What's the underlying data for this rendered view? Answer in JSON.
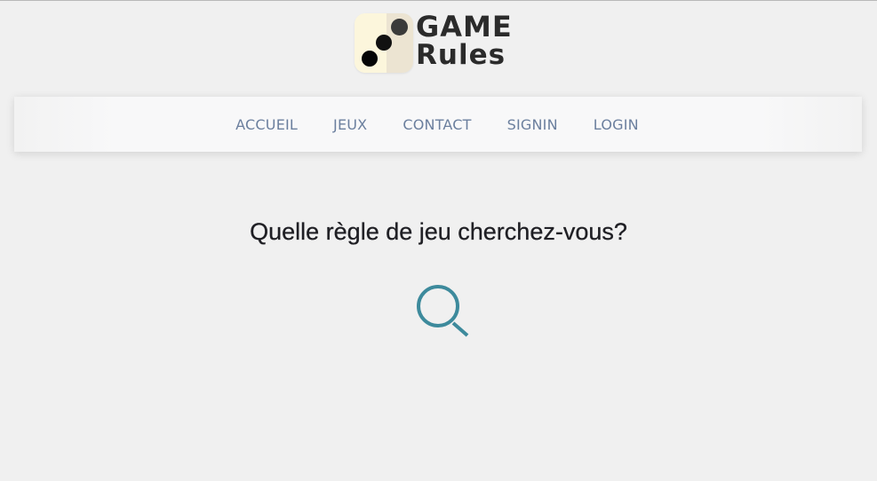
{
  "logo": {
    "line1": "GAME",
    "line2": "Rules"
  },
  "nav": {
    "items": [
      {
        "label": "ACCUEIL"
      },
      {
        "label": "JEUX"
      },
      {
        "label": "CONTACT"
      },
      {
        "label": "SIGNIN"
      },
      {
        "label": "LOGIN"
      }
    ]
  },
  "main": {
    "heading": "Quelle règle de jeu cherchez-vous?",
    "search_icon": "search-icon"
  },
  "colors": {
    "background": "#f0f0f0",
    "nav_text": "#6b7f9e",
    "search_icon": "#3d8a9c",
    "heading_text": "#1f1f24"
  }
}
